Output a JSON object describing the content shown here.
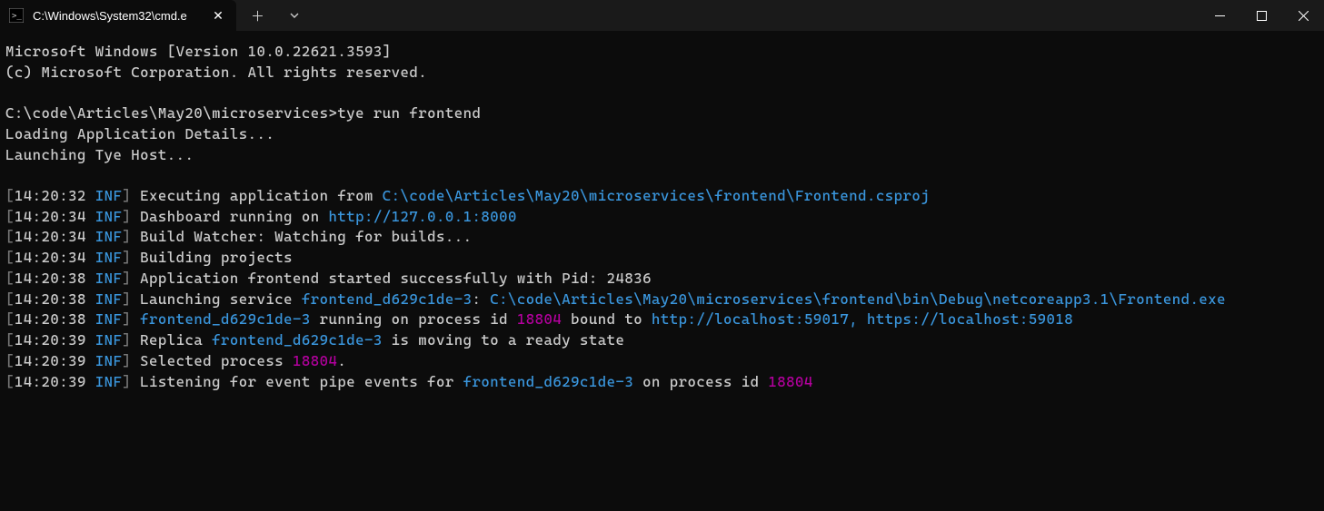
{
  "window": {
    "tab_title": "C:\\Windows\\System32\\cmd.e"
  },
  "terminal": {
    "banner_line1": "Microsoft Windows [Version 10.0.22621.3593]",
    "banner_line2": "(c) Microsoft Corporation. All rights reserved.",
    "prompt": "C:\\code\\Articles\\May20\\microservices>",
    "command": "tye run frontend",
    "loading_line": "Loading Application Details...",
    "launching_line": "Launching Tye Host...",
    "lines": [
      {
        "ts_open": "[",
        "ts": "14:20:32",
        "ts_level": " INF",
        "ts_close": "] ",
        "parts": [
          {
            "cls": "white",
            "text": "Executing application from "
          },
          {
            "cls": "cyan",
            "text": "C:\\code\\Articles\\May20\\microservices\\frontend\\Frontend.csproj"
          }
        ]
      },
      {
        "ts_open": "[",
        "ts": "14:20:34",
        "ts_level": " INF",
        "ts_close": "] ",
        "parts": [
          {
            "cls": "white",
            "text": "Dashboard running on "
          },
          {
            "cls": "cyan",
            "text": "http://127.0.0.1:8000"
          }
        ]
      },
      {
        "ts_open": "[",
        "ts": "14:20:34",
        "ts_level": " INF",
        "ts_close": "] ",
        "parts": [
          {
            "cls": "white",
            "text": "Build Watcher: Watching for builds..."
          }
        ]
      },
      {
        "ts_open": "[",
        "ts": "14:20:34",
        "ts_level": " INF",
        "ts_close": "] ",
        "parts": [
          {
            "cls": "white",
            "text": "Building projects"
          }
        ]
      },
      {
        "ts_open": "[",
        "ts": "14:20:38",
        "ts_level": " INF",
        "ts_close": "] ",
        "parts": [
          {
            "cls": "white",
            "text": "Application frontend started successfully with Pid: 24836"
          }
        ]
      },
      {
        "ts_open": "[",
        "ts": "14:20:38",
        "ts_level": " INF",
        "ts_close": "] ",
        "parts": [
          {
            "cls": "white",
            "text": "Launching service "
          },
          {
            "cls": "cyan",
            "text": "frontend_d629c1de-3"
          },
          {
            "cls": "white",
            "text": ": "
          },
          {
            "cls": "cyan",
            "text": "C:\\code\\Articles\\May20\\microservices\\frontend\\bin\\Debug\\netcoreapp3.1\\Frontend.exe"
          }
        ]
      },
      {
        "ts_open": "[",
        "ts": "14:20:38",
        "ts_level": " INF",
        "ts_close": "] ",
        "parts": [
          {
            "cls": "cyan",
            "text": "frontend_d629c1de-3"
          },
          {
            "cls": "white",
            "text": " running on process id "
          },
          {
            "cls": "magenta",
            "text": "18804"
          },
          {
            "cls": "white",
            "text": " bound to "
          },
          {
            "cls": "cyan",
            "text": "http://localhost:59017, https://localhost:59018"
          }
        ]
      },
      {
        "ts_open": "[",
        "ts": "14:20:39",
        "ts_level": " INF",
        "ts_close": "] ",
        "parts": [
          {
            "cls": "white",
            "text": "Replica "
          },
          {
            "cls": "cyan",
            "text": "frontend_d629c1de-3"
          },
          {
            "cls": "white",
            "text": " is moving to a ready state"
          }
        ]
      },
      {
        "ts_open": "[",
        "ts": "14:20:39",
        "ts_level": " INF",
        "ts_close": "] ",
        "parts": [
          {
            "cls": "white",
            "text": "Selected process "
          },
          {
            "cls": "magenta",
            "text": "18804"
          },
          {
            "cls": "white",
            "text": "."
          }
        ]
      },
      {
        "ts_open": "[",
        "ts": "14:20:39",
        "ts_level": " INF",
        "ts_close": "] ",
        "parts": [
          {
            "cls": "white",
            "text": "Listening for event pipe events for "
          },
          {
            "cls": "cyan",
            "text": "frontend_d629c1de-3"
          },
          {
            "cls": "white",
            "text": " on process id "
          },
          {
            "cls": "magenta",
            "text": "18804"
          }
        ]
      }
    ]
  }
}
